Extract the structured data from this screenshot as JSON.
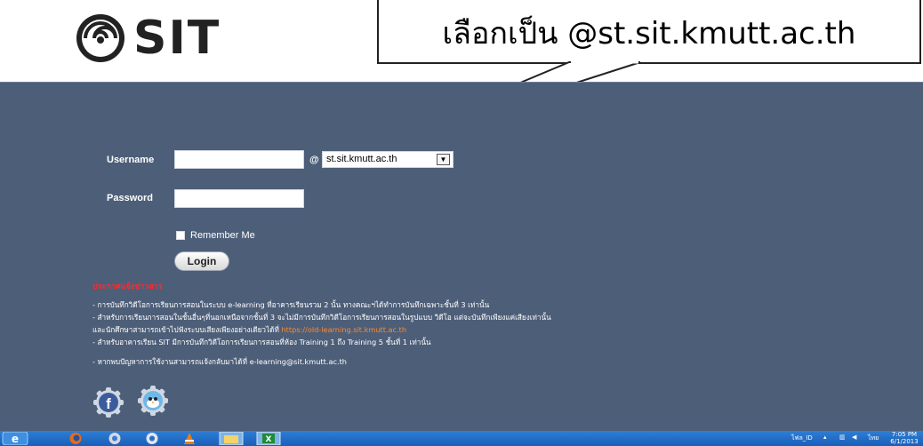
{
  "header": {
    "logo_text": "SIT"
  },
  "callout": {
    "text": "เลือกเป็น @st.sit.kmutt.ac.th"
  },
  "login": {
    "username_label": "Username",
    "username_value": "",
    "at_sign": "@",
    "domain_selected": "st.sit.kmutt.ac.th",
    "password_label": "Password",
    "password_value": "",
    "remember_label": "Remember Me",
    "remember_checked": false,
    "login_button": "Login"
  },
  "notice": {
    "title": "ประกาศแจ้งข่าวสาร",
    "line1": "- การบันทึกวิดีโอการเรียนการสอนในระบบ e-learning ที่อาคารเรียนรวม 2 นั้น ทางคณะฯได้ทำการบันทึกเฉพาะชั้นที่ 3 เท่านั้น",
    "line2": "- สำหรับการเรียนการสอนในชั้นอื่นๆที่นอกเหนือจากชั้นที่ 3 จะไม่มีการบันทึกวิดีโอการเรียนการสอนในรูปแบบ วิดีโอ แต่จะบันทึกเพียงแค่เสียงเท่านั้น",
    "line3_text": "และนักศึกษาสามารถเข้าไปฟังระบบเสียงเพียงอย่างเดียวได้ที่ ",
    "line3_link": "https://old-learning.sit.kmutt.ac.th",
    "line4": "- สำหรับอาคารเรียน SIT มีการบันทึกวิดีโอการเรียนการสอนที่ห้อง Training 1 ถึง Training 5 ชั้นที่ 1 เท่านั้น",
    "line5": "- หากพบปัญหาการใช้งานสามารถแจ้งกลับมาได้ที่ e-learning@sit.kmutt.ac.th"
  },
  "taskbar": {
    "tray_lang": "ไทย",
    "tray_label": "ไฟล_ID",
    "time": "7:05 PM",
    "date": "6/1/2013"
  },
  "colors": {
    "panel": "#4d5e78",
    "notice_title": "#ff2a2a",
    "link": "#ff8a2a",
    "taskbar": "#1a5eb8"
  }
}
